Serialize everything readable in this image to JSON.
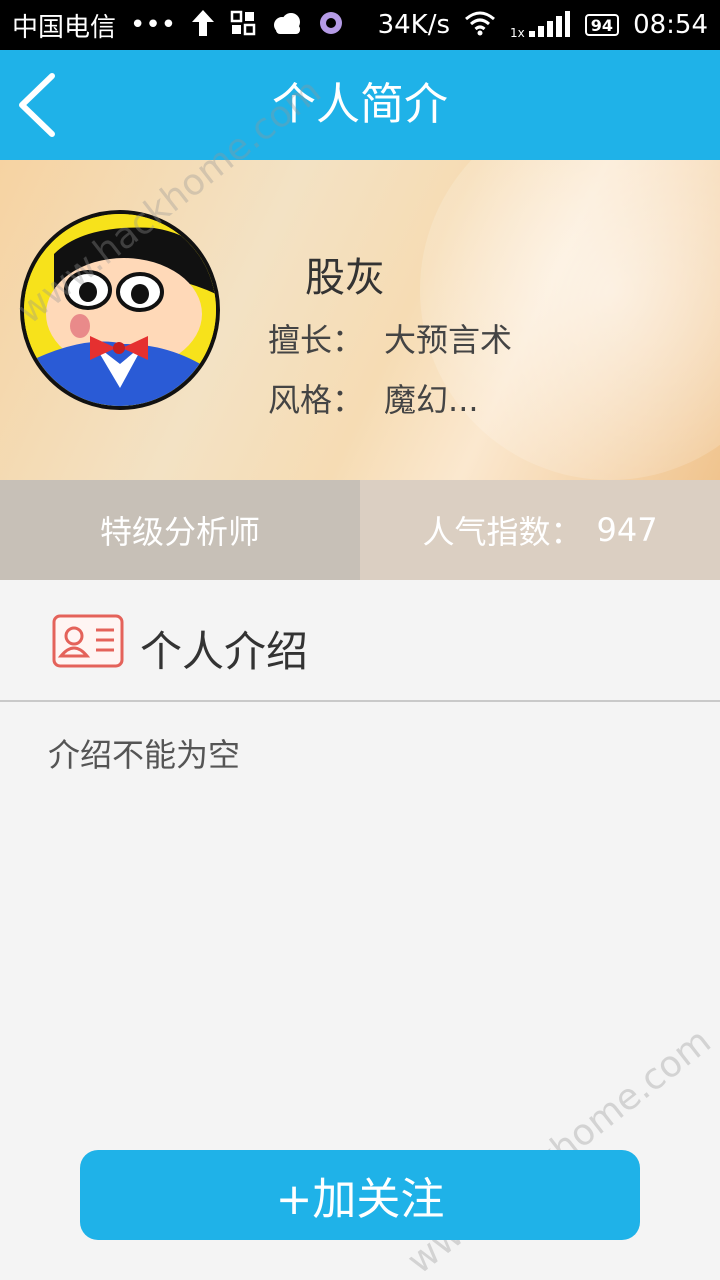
{
  "status_bar": {
    "carrier": "中国电信",
    "dots": "•••",
    "speed": "34K/s",
    "battery": "94",
    "time": "08:54",
    "signal_label": "1x"
  },
  "header": {
    "title": "个人简介"
  },
  "profile": {
    "name": "股灰",
    "specialty_label": "擅长：",
    "specialty_value": "大预言术",
    "style_label": "风格：",
    "style_value": "魔幻..."
  },
  "stats": {
    "rank": "特级分析师",
    "popularity_label": "人气指数：",
    "popularity_value": "947"
  },
  "section": {
    "title": "个人介绍",
    "intro": "介绍不能为空"
  },
  "actions": {
    "follow_label": "+加关注"
  },
  "watermark": {
    "text": "www.hackhome.com"
  },
  "colors": {
    "accent": "#1fb2e8"
  }
}
